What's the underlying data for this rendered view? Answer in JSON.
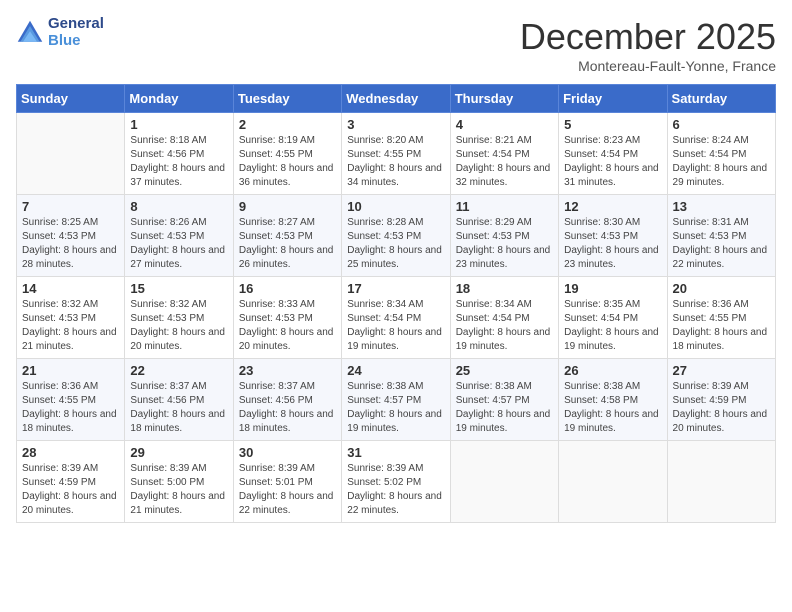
{
  "header": {
    "logo_line1": "General",
    "logo_line2": "Blue",
    "month_title": "December 2025",
    "location": "Montereau-Fault-Yonne, France"
  },
  "weekdays": [
    "Sunday",
    "Monday",
    "Tuesday",
    "Wednesday",
    "Thursday",
    "Friday",
    "Saturday"
  ],
  "weeks": [
    [
      {
        "day": "",
        "sunrise": "",
        "sunset": "",
        "daylight": ""
      },
      {
        "day": "1",
        "sunrise": "Sunrise: 8:18 AM",
        "sunset": "Sunset: 4:56 PM",
        "daylight": "Daylight: 8 hours and 37 minutes."
      },
      {
        "day": "2",
        "sunrise": "Sunrise: 8:19 AM",
        "sunset": "Sunset: 4:55 PM",
        "daylight": "Daylight: 8 hours and 36 minutes."
      },
      {
        "day": "3",
        "sunrise": "Sunrise: 8:20 AM",
        "sunset": "Sunset: 4:55 PM",
        "daylight": "Daylight: 8 hours and 34 minutes."
      },
      {
        "day": "4",
        "sunrise": "Sunrise: 8:21 AM",
        "sunset": "Sunset: 4:54 PM",
        "daylight": "Daylight: 8 hours and 32 minutes."
      },
      {
        "day": "5",
        "sunrise": "Sunrise: 8:23 AM",
        "sunset": "Sunset: 4:54 PM",
        "daylight": "Daylight: 8 hours and 31 minutes."
      },
      {
        "day": "6",
        "sunrise": "Sunrise: 8:24 AM",
        "sunset": "Sunset: 4:54 PM",
        "daylight": "Daylight: 8 hours and 29 minutes."
      }
    ],
    [
      {
        "day": "7",
        "sunrise": "Sunrise: 8:25 AM",
        "sunset": "Sunset: 4:53 PM",
        "daylight": "Daylight: 8 hours and 28 minutes."
      },
      {
        "day": "8",
        "sunrise": "Sunrise: 8:26 AM",
        "sunset": "Sunset: 4:53 PM",
        "daylight": "Daylight: 8 hours and 27 minutes."
      },
      {
        "day": "9",
        "sunrise": "Sunrise: 8:27 AM",
        "sunset": "Sunset: 4:53 PM",
        "daylight": "Daylight: 8 hours and 26 minutes."
      },
      {
        "day": "10",
        "sunrise": "Sunrise: 8:28 AM",
        "sunset": "Sunset: 4:53 PM",
        "daylight": "Daylight: 8 hours and 25 minutes."
      },
      {
        "day": "11",
        "sunrise": "Sunrise: 8:29 AM",
        "sunset": "Sunset: 4:53 PM",
        "daylight": "Daylight: 8 hours and 23 minutes."
      },
      {
        "day": "12",
        "sunrise": "Sunrise: 8:30 AM",
        "sunset": "Sunset: 4:53 PM",
        "daylight": "Daylight: 8 hours and 23 minutes."
      },
      {
        "day": "13",
        "sunrise": "Sunrise: 8:31 AM",
        "sunset": "Sunset: 4:53 PM",
        "daylight": "Daylight: 8 hours and 22 minutes."
      }
    ],
    [
      {
        "day": "14",
        "sunrise": "Sunrise: 8:32 AM",
        "sunset": "Sunset: 4:53 PM",
        "daylight": "Daylight: 8 hours and 21 minutes."
      },
      {
        "day": "15",
        "sunrise": "Sunrise: 8:32 AM",
        "sunset": "Sunset: 4:53 PM",
        "daylight": "Daylight: 8 hours and 20 minutes."
      },
      {
        "day": "16",
        "sunrise": "Sunrise: 8:33 AM",
        "sunset": "Sunset: 4:53 PM",
        "daylight": "Daylight: 8 hours and 20 minutes."
      },
      {
        "day": "17",
        "sunrise": "Sunrise: 8:34 AM",
        "sunset": "Sunset: 4:54 PM",
        "daylight": "Daylight: 8 hours and 19 minutes."
      },
      {
        "day": "18",
        "sunrise": "Sunrise: 8:34 AM",
        "sunset": "Sunset: 4:54 PM",
        "daylight": "Daylight: 8 hours and 19 minutes."
      },
      {
        "day": "19",
        "sunrise": "Sunrise: 8:35 AM",
        "sunset": "Sunset: 4:54 PM",
        "daylight": "Daylight: 8 hours and 19 minutes."
      },
      {
        "day": "20",
        "sunrise": "Sunrise: 8:36 AM",
        "sunset": "Sunset: 4:55 PM",
        "daylight": "Daylight: 8 hours and 18 minutes."
      }
    ],
    [
      {
        "day": "21",
        "sunrise": "Sunrise: 8:36 AM",
        "sunset": "Sunset: 4:55 PM",
        "daylight": "Daylight: 8 hours and 18 minutes."
      },
      {
        "day": "22",
        "sunrise": "Sunrise: 8:37 AM",
        "sunset": "Sunset: 4:56 PM",
        "daylight": "Daylight: 8 hours and 18 minutes."
      },
      {
        "day": "23",
        "sunrise": "Sunrise: 8:37 AM",
        "sunset": "Sunset: 4:56 PM",
        "daylight": "Daylight: 8 hours and 18 minutes."
      },
      {
        "day": "24",
        "sunrise": "Sunrise: 8:38 AM",
        "sunset": "Sunset: 4:57 PM",
        "daylight": "Daylight: 8 hours and 19 minutes."
      },
      {
        "day": "25",
        "sunrise": "Sunrise: 8:38 AM",
        "sunset": "Sunset: 4:57 PM",
        "daylight": "Daylight: 8 hours and 19 minutes."
      },
      {
        "day": "26",
        "sunrise": "Sunrise: 8:38 AM",
        "sunset": "Sunset: 4:58 PM",
        "daylight": "Daylight: 8 hours and 19 minutes."
      },
      {
        "day": "27",
        "sunrise": "Sunrise: 8:39 AM",
        "sunset": "Sunset: 4:59 PM",
        "daylight": "Daylight: 8 hours and 20 minutes."
      }
    ],
    [
      {
        "day": "28",
        "sunrise": "Sunrise: 8:39 AM",
        "sunset": "Sunset: 4:59 PM",
        "daylight": "Daylight: 8 hours and 20 minutes."
      },
      {
        "day": "29",
        "sunrise": "Sunrise: 8:39 AM",
        "sunset": "Sunset: 5:00 PM",
        "daylight": "Daylight: 8 hours and 21 minutes."
      },
      {
        "day": "30",
        "sunrise": "Sunrise: 8:39 AM",
        "sunset": "Sunset: 5:01 PM",
        "daylight": "Daylight: 8 hours and 22 minutes."
      },
      {
        "day": "31",
        "sunrise": "Sunrise: 8:39 AM",
        "sunset": "Sunset: 5:02 PM",
        "daylight": "Daylight: 8 hours and 22 minutes."
      },
      {
        "day": "",
        "sunrise": "",
        "sunset": "",
        "daylight": ""
      },
      {
        "day": "",
        "sunrise": "",
        "sunset": "",
        "daylight": ""
      },
      {
        "day": "",
        "sunrise": "",
        "sunset": "",
        "daylight": ""
      }
    ]
  ]
}
